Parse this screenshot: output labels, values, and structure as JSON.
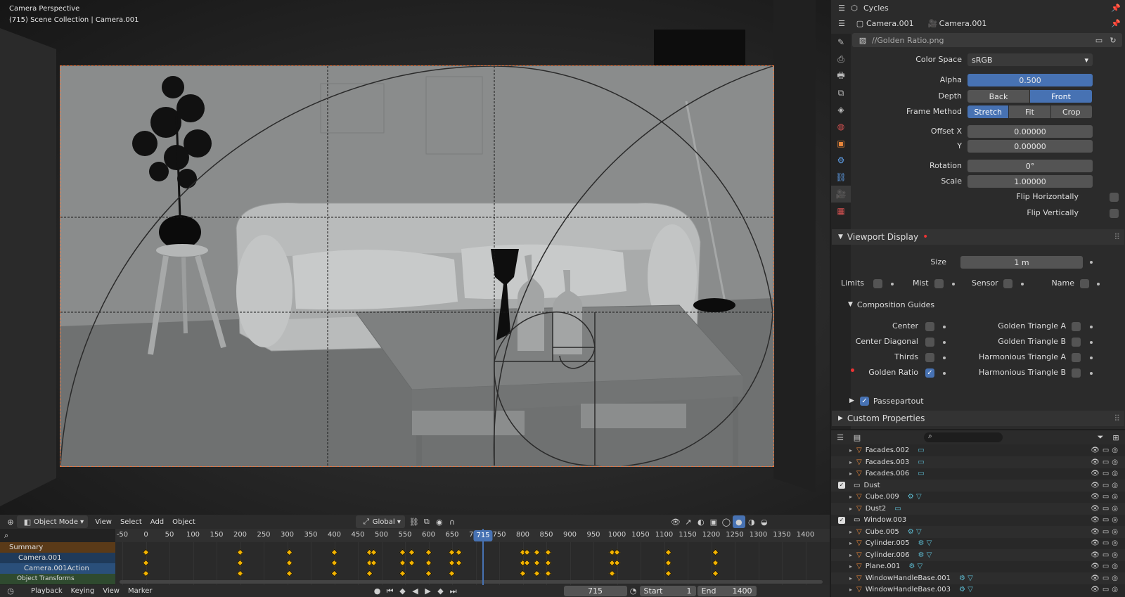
{
  "viewport": {
    "header1": "Camera Perspective",
    "header2": "(715) Scene Collection | Camera.001",
    "mode": "Object Mode",
    "menu": [
      "View",
      "Select",
      "Add",
      "Object"
    ],
    "transform": "Global"
  },
  "timeline": {
    "channels": [
      "Summary",
      "Camera.001",
      "Camera.001Action",
      "Object Transforms"
    ],
    "ticks": [
      "-50",
      "0",
      "50",
      "100",
      "150",
      "200",
      "250",
      "300",
      "350",
      "400",
      "450",
      "500",
      "550",
      "600",
      "650",
      "700",
      "750",
      "800",
      "850",
      "900",
      "950",
      "1000",
      "1050",
      "1100",
      "1150",
      "1200",
      "1250",
      "1300",
      "1350",
      "1400"
    ],
    "current_frame": "715",
    "footer": {
      "menus": [
        "Playback",
        "Keying",
        "View",
        "Marker"
      ],
      "frame": "715",
      "start_label": "Start",
      "start": "1",
      "end_label": "End",
      "end": "1400"
    }
  },
  "properties": {
    "engine": "Cycles",
    "object_name": "Camera.001",
    "data_name": "Camera.001",
    "image_path": "//Golden Ratio.png",
    "color_space_label": "Color Space",
    "color_space": "sRGB",
    "alpha_label": "Alpha",
    "alpha": "0.500",
    "depth_label": "Depth",
    "depth_options": [
      "Back",
      "Front"
    ],
    "frame_method_label": "Frame Method",
    "frame_method_options": [
      "Stretch",
      "Fit",
      "Crop"
    ],
    "offset_x_label": "Offset X",
    "offset_x": "0.00000",
    "offset_y_label": "Y",
    "offset_y": "0.00000",
    "rotation_label": "Rotation",
    "rotation": "0°",
    "scale_label": "Scale",
    "scale": "1.00000",
    "flip_h": "Flip Horizontally",
    "flip_v": "Flip Vertically",
    "viewport_display": "Viewport Display",
    "size_label": "Size",
    "size": "1 m",
    "limits": "Limits",
    "mist": "Mist",
    "sensor": "Sensor",
    "name": "Name",
    "composition_guides": "Composition Guides",
    "guides_left": [
      "Center",
      "Center Diagonal",
      "Thirds",
      "Golden Ratio"
    ],
    "guides_right": [
      "Golden Triangle A",
      "Golden Triangle B",
      "Harmonious Triangle A",
      "Harmonious Triangle B"
    ],
    "passepartout": "Passepartout",
    "custom_properties": "Custom Properties"
  },
  "outliner": {
    "items": [
      {
        "name": "Facades.002",
        "type": "mesh"
      },
      {
        "name": "Facades.003",
        "type": "mesh"
      },
      {
        "name": "Facades.006",
        "type": "mesh"
      },
      {
        "name": "Dust",
        "type": "collection"
      },
      {
        "name": "Cube.009",
        "type": "mesh"
      },
      {
        "name": "Dust2",
        "type": "mesh"
      },
      {
        "name": "Window.003",
        "type": "collection"
      },
      {
        "name": "Cube.005",
        "type": "mesh"
      },
      {
        "name": "Cylinder.005",
        "type": "mesh"
      },
      {
        "name": "Cylinder.006",
        "type": "mesh"
      },
      {
        "name": "Plane.001",
        "type": "mesh"
      },
      {
        "name": "WindowHandleBase.001",
        "type": "mesh"
      },
      {
        "name": "WindowHandleBase.003",
        "type": "mesh"
      }
    ]
  },
  "colors": {
    "accent": "#4772b3",
    "keyframe": "#f3b300",
    "camera_frame": "#e9733b"
  }
}
